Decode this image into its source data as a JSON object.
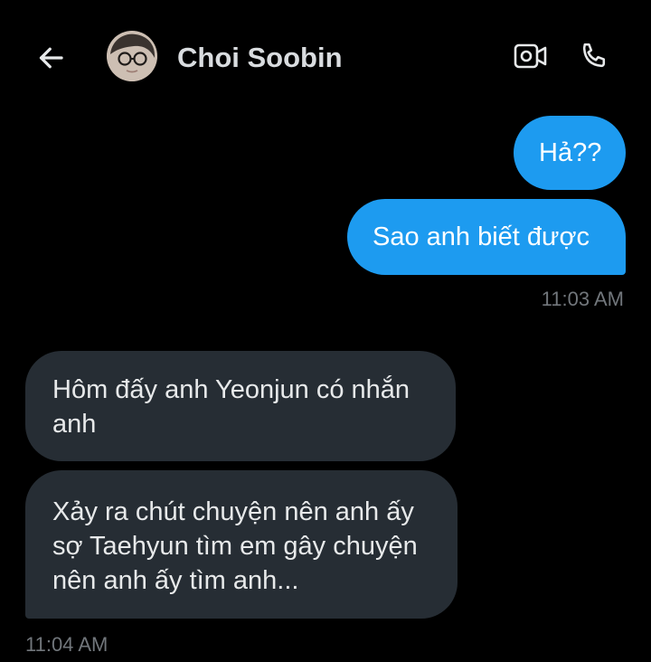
{
  "header": {
    "contact_name": "Choi Soobin",
    "icons": {
      "back": "arrow-left-icon",
      "video": "video-camera-icon",
      "call": "phone-icon"
    }
  },
  "messages": [
    {
      "direction": "sent",
      "text": "Hả??"
    },
    {
      "direction": "sent",
      "text": "Sao anh biết được"
    },
    {
      "direction": "received",
      "text": "Hôm đấy anh Yeonjun có nhắn anh"
    },
    {
      "direction": "received",
      "text": "Xảy ra chút chuyện nên anh ấy sợ Taehyun tìm em gây chuyện nên anh ấy tìm anh..."
    }
  ],
  "timestamps": {
    "sent_group": "11:03 AM",
    "received_group": "11:04 AM"
  },
  "colors": {
    "background": "#000000",
    "sent_bubble": "#1d9bf0",
    "received_bubble": "#262d34",
    "timestamp": "#71767b"
  }
}
